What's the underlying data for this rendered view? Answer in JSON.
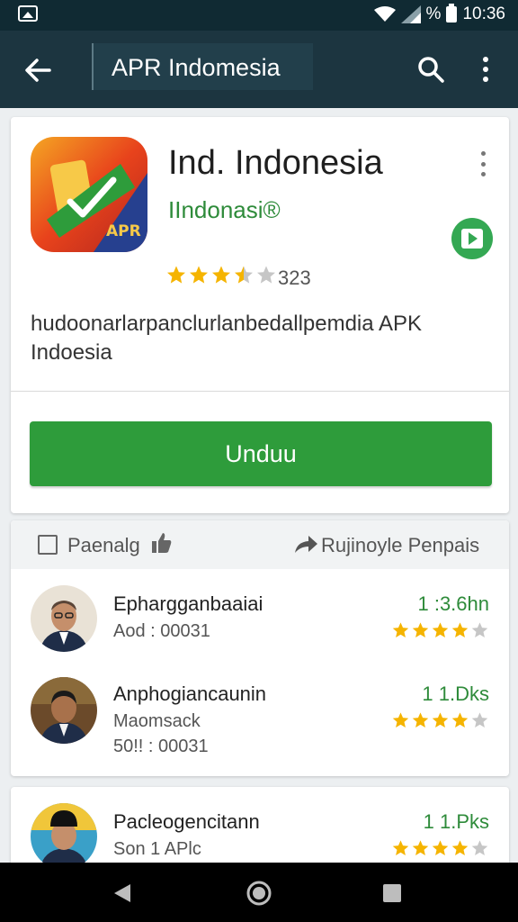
{
  "status_bar": {
    "battery_text": "%",
    "time": "10:36"
  },
  "app_bar": {
    "query": "APR Indomesia"
  },
  "app": {
    "title": "Ind. Indonesia",
    "developer": "IIndonasi®",
    "rating": 3.5,
    "rating_count": "323",
    "description": "hudoonarlarpanclurlanbedallpemdia APK Indoesia",
    "install_label": "Unduu",
    "icon_badge": "APR"
  },
  "reviews_header": {
    "wishlist_label": "Paenalg",
    "share_label": "Rujinoyle Penpais"
  },
  "reviews": [
    {
      "name": "Ephargganbaaiai",
      "sub1": "Aod : 00031",
      "sub2": "",
      "score": "1 :3.6hn",
      "stars": 4
    },
    {
      "name": "Anphogiancaunin",
      "sub1": "Maomsack",
      "sub2": "50!! : 00031",
      "score": "1 1.Dks",
      "stars": 4
    },
    {
      "name": "Pacleogencitann",
      "sub1": "Son 1 APlc",
      "sub2": "",
      "score": "1 1.Pks",
      "stars": 4
    }
  ],
  "colors": {
    "app_bar": "#1c3540",
    "accent_green": "#2e9c3b",
    "star": "#f5b400",
    "star_empty": "#c6c6c6"
  }
}
